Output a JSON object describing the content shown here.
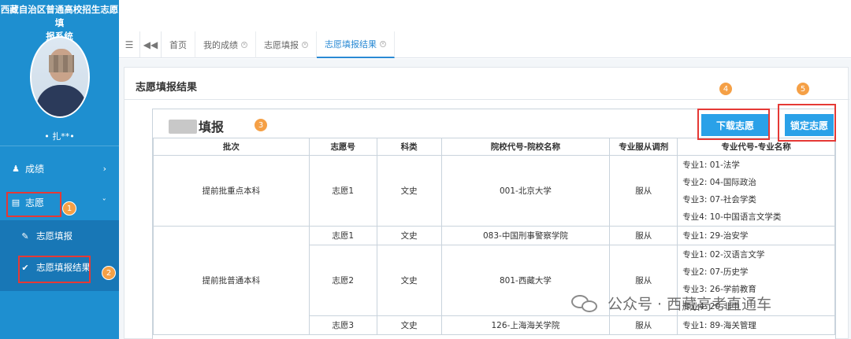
{
  "sidebar": {
    "system_title_line1": "西藏自治区普通高校招生志愿填",
    "system_title_line2": "报系统",
    "user_name": "• 扎**•",
    "nav": [
      {
        "label": "成绩",
        "icon": "user-icon"
      },
      {
        "label": "志愿",
        "icon": "bank-icon"
      }
    ],
    "sub_nav": [
      {
        "label": "志愿填报",
        "icon": "edit-icon"
      },
      {
        "label": "志愿填报结果",
        "icon": "check-icon"
      }
    ]
  },
  "badges": [
    "1",
    "2",
    "3",
    "4",
    "5"
  ],
  "topbar": {
    "tabs": [
      {
        "label": "首页"
      },
      {
        "label": "我的成绩"
      },
      {
        "label": "志愿填报"
      },
      {
        "label": "志愿填报结果"
      }
    ]
  },
  "panel": {
    "title": "志愿填报结果",
    "card_title": "填报",
    "download_button": "下载志愿",
    "lock_button": "锁定志愿"
  },
  "table": {
    "headers": [
      "批次",
      "志愿号",
      "科类",
      "院校代号-院校名称",
      "专业服从调剂",
      "专业代号-专业名称"
    ],
    "groups": [
      {
        "batch": "提前批重点本科",
        "rows": [
          {
            "no": "志愿1",
            "type": "文史",
            "school": "001-北京大学",
            "adjust": "服从",
            "majors": [
              "专业1: 01-法学",
              "专业2: 04-国际政治",
              "专业3: 07-社会学类",
              "专业4: 10-中国语言文学类"
            ]
          }
        ]
      },
      {
        "batch": "提前批普通本科",
        "rows": [
          {
            "no": "志愿1",
            "type": "文史",
            "school": "083-中国刑事警察学院",
            "adjust": "服从",
            "majors": [
              "专业1: 29-治安学"
            ]
          },
          {
            "no": "志愿2",
            "type": "文史",
            "school": "801-西藏大学",
            "adjust": "服从",
            "majors": [
              "专业1: 02-汉语言文学",
              "专业2: 07-历史学",
              "专业3: 26-学前教育",
              "专业4: 20-非中"
            ]
          },
          {
            "no": "志愿3",
            "type": "文史",
            "school": "126-上海海关学院",
            "adjust": "服从",
            "majors": [
              "专业1: 89-海关管理"
            ]
          }
        ]
      }
    ]
  },
  "watermark": "公众号 · 西藏高考直通车"
}
